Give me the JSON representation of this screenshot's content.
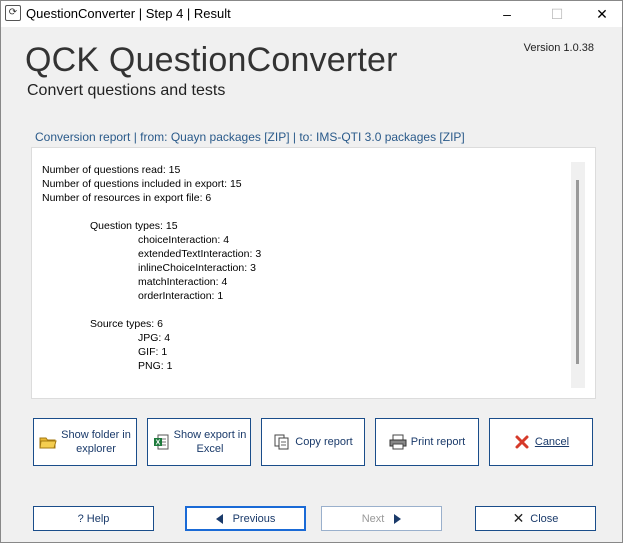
{
  "window": {
    "title": "QuestionConverter | Step 4 | Result",
    "app_icon": "refresh-icon",
    "minimize": "–",
    "maximize": "☐",
    "close": "✕"
  },
  "header": {
    "title": "QCK QuestionConverter",
    "subtitle": "Convert questions and tests",
    "version": "Version 1.0.38"
  },
  "report": {
    "caption": "Conversion report | from: Quayn packages [ZIP] | to: IMS-QTI 3.0 packages [ZIP]",
    "lines": {
      "l1": "Number of questions read: 15",
      "l2": "Number of questions included in export: 15",
      "l3": "Number of resources in export file: 6",
      "l4": "Question types: 15",
      "l5": "choiceInteraction: 4",
      "l6": "extendedTextInteraction: 3",
      "l7": "inlineChoiceInteraction: 3",
      "l8": "matchInteraction: 4",
      "l9": "orderInteraction: 1",
      "l10": "Source types: 6",
      "l11": "JPG: 4",
      "l12": "GIF: 1",
      "l13": "PNG: 1"
    }
  },
  "actions": {
    "show_folder": {
      "line1": "Show folder in",
      "line2": "explorer",
      "icon": "folder-icon"
    },
    "show_excel": {
      "line1": "Show export in",
      "line2": "Excel",
      "icon": "excel-icon"
    },
    "copy_report": {
      "label": "Copy report",
      "icon": "copy-icon"
    },
    "print_report": {
      "label": "Print report",
      "icon": "printer-icon"
    },
    "cancel": {
      "label": "Cancel",
      "icon": "cancel-icon"
    }
  },
  "nav": {
    "help": "? Help",
    "previous": "Previous",
    "next": "Next",
    "close": "Close"
  },
  "colors": {
    "accent": "#1a4d8a",
    "caption": "#2a5a8a",
    "cancel_icon": "#d63a2a"
  }
}
